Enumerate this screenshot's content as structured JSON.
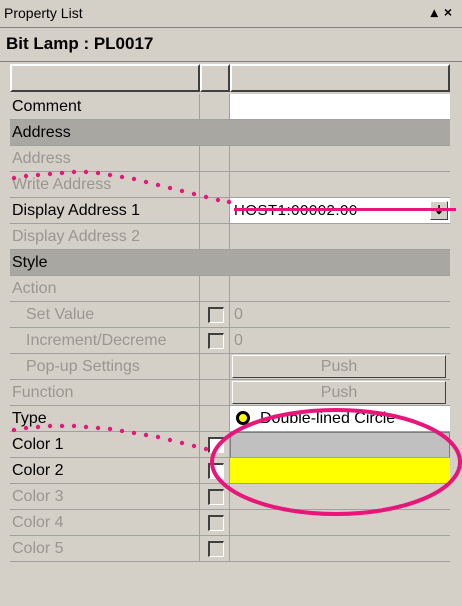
{
  "window": {
    "title": "Property List",
    "pin_glyph": "▴",
    "close_glyph": "×"
  },
  "object": {
    "name": "Bit Lamp : PL0017"
  },
  "rows": {
    "comment": {
      "label": "Comment"
    },
    "address_section": {
      "label": "Address"
    },
    "address": {
      "label": "Address"
    },
    "write_address": {
      "label": "Write Address"
    },
    "display_address1": {
      "label": "Display Address 1",
      "value": "HOST1:00002.00",
      "arrow": "↡"
    },
    "display_address2": {
      "label": "Display Address 2"
    },
    "style_section": {
      "label": "Style"
    },
    "action": {
      "label": "Action"
    },
    "set_value": {
      "label": "Set Value",
      "value": "0"
    },
    "increment": {
      "label": "Increment/Decreme",
      "value": "0"
    },
    "popup": {
      "label": "Pop-up Settings",
      "value": "Push"
    },
    "function": {
      "label": "Function",
      "value": "Push"
    },
    "type": {
      "label": "Type",
      "value": "Double-lined Circle"
    },
    "color1": {
      "label": "Color 1"
    },
    "color2": {
      "label": "Color 2"
    },
    "color3": {
      "label": "Color 3"
    },
    "color4": {
      "label": "Color 4"
    },
    "color5": {
      "label": "Color 5"
    }
  },
  "colors": {
    "annotation": "#e8157a",
    "color2_swatch": "#ffff00",
    "color1_swatch": "#c0c0c0"
  }
}
